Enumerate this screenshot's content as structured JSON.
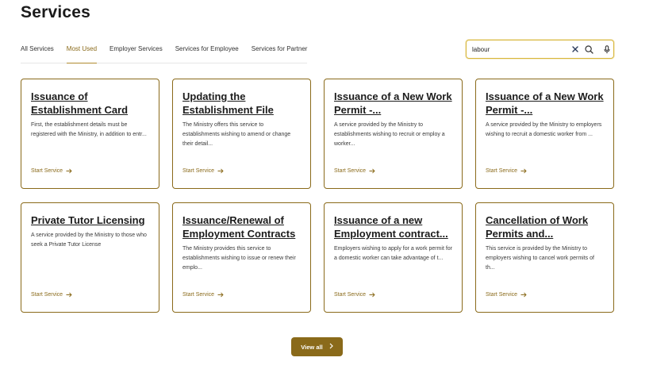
{
  "page": {
    "title": "Services"
  },
  "tabs": [
    {
      "label": "All Services",
      "active": false
    },
    {
      "label": "Most Used",
      "active": true
    },
    {
      "label": "Employer Services",
      "active": false
    },
    {
      "label": "Services for Employee",
      "active": false
    },
    {
      "label": "Services for Partner",
      "active": false
    }
  ],
  "search": {
    "value": "labour",
    "clear_icon": "close-icon",
    "search_icon": "search-icon",
    "mic_icon": "microphone-icon"
  },
  "cards": [
    {
      "title": "Issuance of Establishment Card",
      "description": "First, the establishment details must be registered with the Ministry, in addition to entr...",
      "link": "Start Service"
    },
    {
      "title": "Updating the Establishment File",
      "description": "The Ministry offers this service to establishments wishing to amend or change their detail...",
      "link": "Start Service"
    },
    {
      "title": "Issuance of a New Work Permit -...",
      "description": "A service provided by the Ministry to establishments wishing to recruit or employ a worker...",
      "link": "Start Service"
    },
    {
      "title": "Issuance of a New Work Permit -...",
      "description": "A service provided by the Ministry to employers wishing to recruit a domestic worker from ...",
      "link": "Start Service"
    },
    {
      "title": "Private Tutor Licensing",
      "description": "A service provided by the Ministry to those who seek a Private Tutor License",
      "link": "Start Service"
    },
    {
      "title": "Issuance/Renewal of Employment Contracts",
      "description": "The Ministry provides this service to establishments wishing to issue or renew their emplo...",
      "link": "Start Service"
    },
    {
      "title": "Issuance of a new Employment contract...",
      "description": "Employers wishing to apply for a work permit for a domestic worker can take advantage of t...",
      "link": "Start Service"
    },
    {
      "title": "Cancellation of Work Permits and...",
      "description": "This service is provided by the Ministry to employers wishing to cancel work permits of th...",
      "link": "Start Service"
    }
  ],
  "view_all": {
    "label": "View all"
  },
  "colors": {
    "accent": "#8a6a1a",
    "search_border": "#d8b63a"
  }
}
